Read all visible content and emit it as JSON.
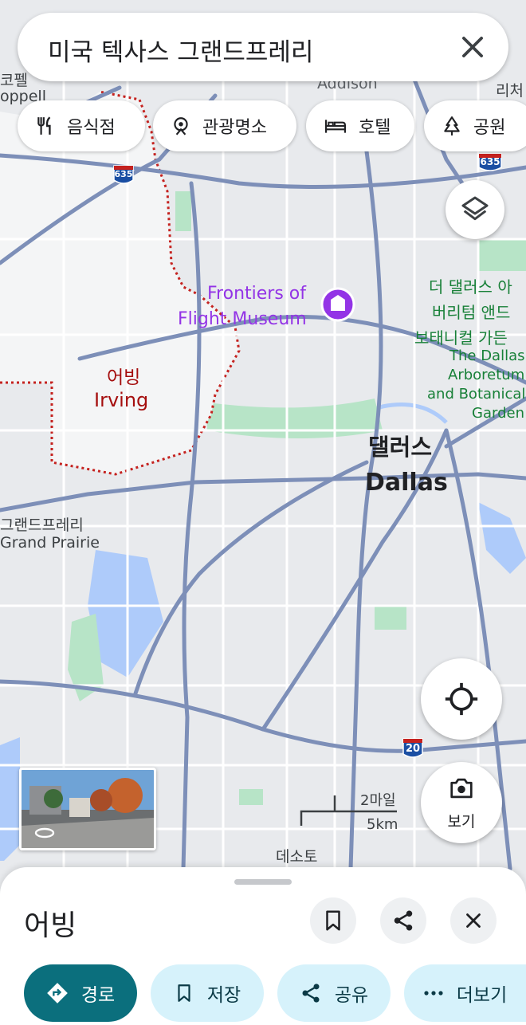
{
  "search": {
    "query": "미국 텍사스 그랜드프레리"
  },
  "chips": [
    {
      "label": "음식점",
      "icon": "restaurant-icon"
    },
    {
      "label": "관광명소",
      "icon": "attraction-icon"
    },
    {
      "label": "호텔",
      "icon": "hotel-icon"
    },
    {
      "label": "공원",
      "icon": "park-icon"
    }
  ],
  "map": {
    "labels": {
      "addison": "Addison",
      "coppell_ko": "코펠",
      "coppell_en": "oppell",
      "richardson": "리처",
      "museum_line1": "Frontiers of",
      "museum_line2": "Flight Museum",
      "arboretum_ko1": "더 댈러스 아",
      "arboretum_ko2": "버리텀 앤드",
      "arboretum_ko3": "보태니컬 가든",
      "arboretum_en1": "The Dallas",
      "arboretum_en2": "Arboretum",
      "arboretum_en3": "and Botanical",
      "arboretum_en4": "Garden",
      "irving_ko": "어빙",
      "irving_en": "Irving",
      "dallas_ko": "댈러스",
      "dallas_en": "Dallas",
      "gp_ko": "그랜드프레리",
      "gp_en": "Grand Prairie",
      "desoto": "데소토"
    },
    "shields": {
      "i635_left": "635",
      "i635_right": "635",
      "i20": "20"
    },
    "scale": {
      "miles": "2마일",
      "km": "5km"
    },
    "colors": {
      "land": "#e8eaed",
      "water": "#aecbfa",
      "park": "#b7e4c7",
      "road": "#ffffff",
      "highway": "#7d8fb8",
      "boundary": "#c5221f",
      "poi": "#9334e6"
    }
  },
  "buttons": {
    "camera_label": "보기"
  },
  "sheet": {
    "title": "어빙",
    "actions": [
      {
        "label": "경로",
        "icon": "directions-icon"
      },
      {
        "label": "저장",
        "icon": "bookmark-icon"
      },
      {
        "label": "공유",
        "icon": "share-icon"
      },
      {
        "label": "더보기",
        "icon": "more-icon"
      }
    ]
  }
}
